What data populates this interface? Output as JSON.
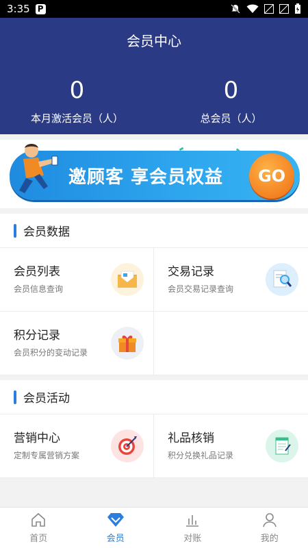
{
  "status_bar": {
    "time": "3:35",
    "app_badge": "P"
  },
  "header": {
    "title": "会员中心",
    "stats": [
      {
        "value": "0",
        "label": "本月激活会员（人）"
      },
      {
        "value": "0",
        "label": "总会员（人）"
      }
    ]
  },
  "banner": {
    "text": "邀顾客 享会员权益",
    "go": "GO"
  },
  "sections": [
    {
      "title": "会员数据",
      "items": [
        {
          "name": "会员列表",
          "desc": "会员信息查询",
          "icon": "envelope-icon",
          "color": "#f5a623"
        },
        {
          "name": "交易记录",
          "desc": "会员交易记录查询",
          "icon": "magnifier-document-icon",
          "color": "#3aa6f0"
        },
        {
          "name": "积分记录",
          "desc": "会员积分的变动记录",
          "icon": "gift-icon",
          "color": "#f07a3a"
        }
      ]
    },
    {
      "title": "会员活动",
      "items": [
        {
          "name": "营销中心",
          "desc": "定制专属营销方案",
          "icon": "target-icon",
          "color": "#e8453c"
        },
        {
          "name": "礼品核销",
          "desc": "积分兑换礼品记录",
          "icon": "notepad-icon",
          "color": "#3bbf8a"
        }
      ]
    }
  ],
  "tabbar": [
    {
      "label": "首页",
      "icon": "home-icon",
      "active": false
    },
    {
      "label": "会员",
      "icon": "diamond-icon",
      "active": true
    },
    {
      "label": "对账",
      "icon": "bar-chart-icon",
      "active": false
    },
    {
      "label": "我的",
      "icon": "person-icon",
      "active": false
    }
  ]
}
